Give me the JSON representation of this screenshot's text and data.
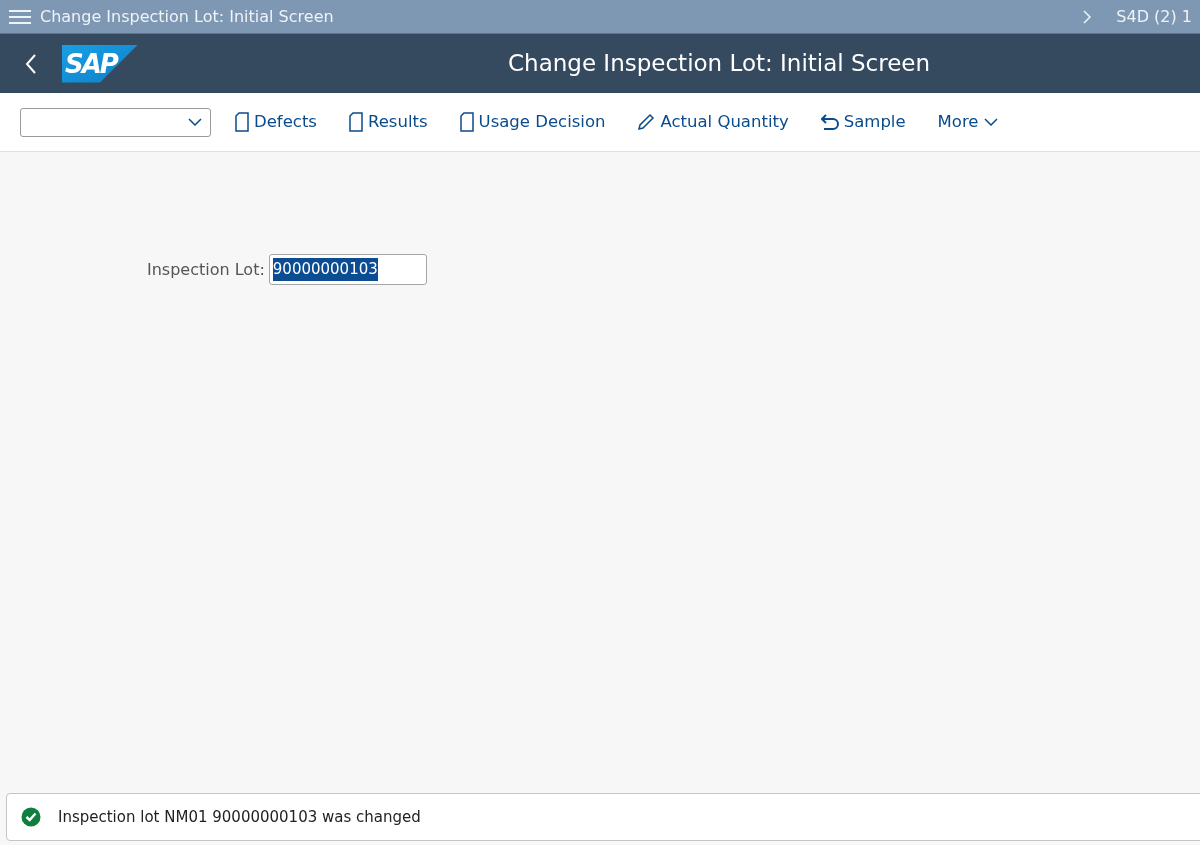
{
  "title_bar": {
    "title": "Change Inspection Lot: Initial Screen",
    "system": "S4D (2) 1"
  },
  "header": {
    "logo": "SAP",
    "title": "Change Inspection Lot: Initial Screen"
  },
  "toolbar": {
    "buttons": [
      {
        "label": "Defects",
        "kind": "document"
      },
      {
        "label": "Results",
        "kind": "document"
      },
      {
        "label": "Usage Decision",
        "kind": "document"
      },
      {
        "label": "Actual Quantity",
        "kind": "edit"
      },
      {
        "label": "Sample",
        "kind": "undo"
      },
      {
        "label": "More",
        "kind": "menu"
      }
    ]
  },
  "form": {
    "label": "Inspection Lot:",
    "value": "90000000103",
    "value_selected": true
  },
  "message": {
    "kind": "success",
    "text": "Inspection lot NM01 90000000103 was changed"
  }
}
